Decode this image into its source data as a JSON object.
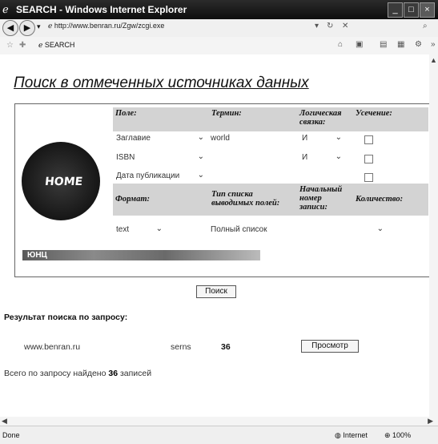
{
  "window": {
    "title": "SEARCH - Windows Internet Explorer",
    "minimize_glyph": "_",
    "maximize_glyph": "□",
    "close_glyph": "×"
  },
  "addressbar": {
    "back_glyph": "◀",
    "forward_glyph": "▶",
    "url": "http://www.benran.ru/Zgw/zcgi.exe"
  },
  "tabbar": {
    "tab_label": "SEARCH"
  },
  "page": {
    "title": "Поиск в отмеченных источниках данных",
    "headers": {
      "field": "Поле:",
      "term": "Термин:",
      "logic": "Логическая связка:",
      "truncation": "Усечение:",
      "format": "Формат:",
      "list_type": "Тип списка выводимых полей:",
      "start_record": "Начальный номер записи:",
      "quantity": "Количество:"
    },
    "rows": [
      {
        "field": "Заглавие",
        "term": "world",
        "logic": "И"
      },
      {
        "field": "ISBN",
        "term": "",
        "logic": "И"
      },
      {
        "field": "Дата публикации",
        "term": "",
        "logic": ""
      }
    ],
    "format_value": "text",
    "list_type_value": "Полный список",
    "quantity_value": "",
    "logo_text": "HOME",
    "banner_text": "ЮНЦ",
    "search_button": "Поиск",
    "result_title": "Результат поиска по запросу:",
    "result_row": {
      "source": "www.benran.ru",
      "term": "serns",
      "count": "36",
      "view_button": "Просмотр"
    },
    "total_prefix": "Всего по запросу найдено",
    "total_count": "36",
    "total_suffix": "записей"
  },
  "status": {
    "done": "Done",
    "zone": "Internet",
    "zoom": "100%"
  },
  "colors": {
    "titlebar": "#1a1a1a",
    "header_bg": "#d3d3d3"
  }
}
